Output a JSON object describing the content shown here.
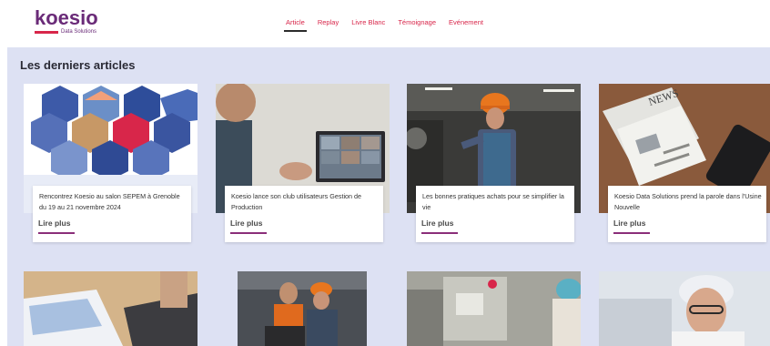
{
  "header": {
    "logo_text": "koesio",
    "logo_subtext": "Data Solutions",
    "nav": [
      {
        "label": "Article",
        "active": true
      },
      {
        "label": "Replay",
        "active": false
      },
      {
        "label": "Livre Blanc",
        "active": false
      },
      {
        "label": "Témoignage",
        "active": false
      },
      {
        "label": "Evénement",
        "active": false
      }
    ]
  },
  "main": {
    "section_title": "Les derniers articles",
    "articles": [
      {
        "title": "Rencontrez Koesio au salon SEPEM à Grenoble du 19 au 21 novembre 2024",
        "link": "Lire plus",
        "image_icon": "hexagon-collage-image"
      },
      {
        "title": "Koesio lance son club utilisateurs Gestion de Production",
        "link": "Lire plus",
        "image_icon": "video-call-image"
      },
      {
        "title": "Les bonnes pratiques achats pour se simplifier la vie",
        "link": "Lire plus",
        "image_icon": "factory-worker-image"
      },
      {
        "title": "Koesio Data Solutions prend la parole dans l'Usine Nouvelle",
        "link": "Lire plus",
        "image_icon": "newspaper-image"
      }
    ],
    "second_row": [
      {
        "image_icon": "laptop-charts-image"
      },
      {
        "image_icon": "workers-laptop-image"
      },
      {
        "image_icon": "machine-image"
      },
      {
        "image_icon": "lab-worker-image"
      }
    ]
  },
  "colors": {
    "brand_purple": "#6a2b78",
    "brand_red": "#d8264a",
    "background_band": "#dde1f3",
    "link_underline": "#8a2e7a"
  }
}
